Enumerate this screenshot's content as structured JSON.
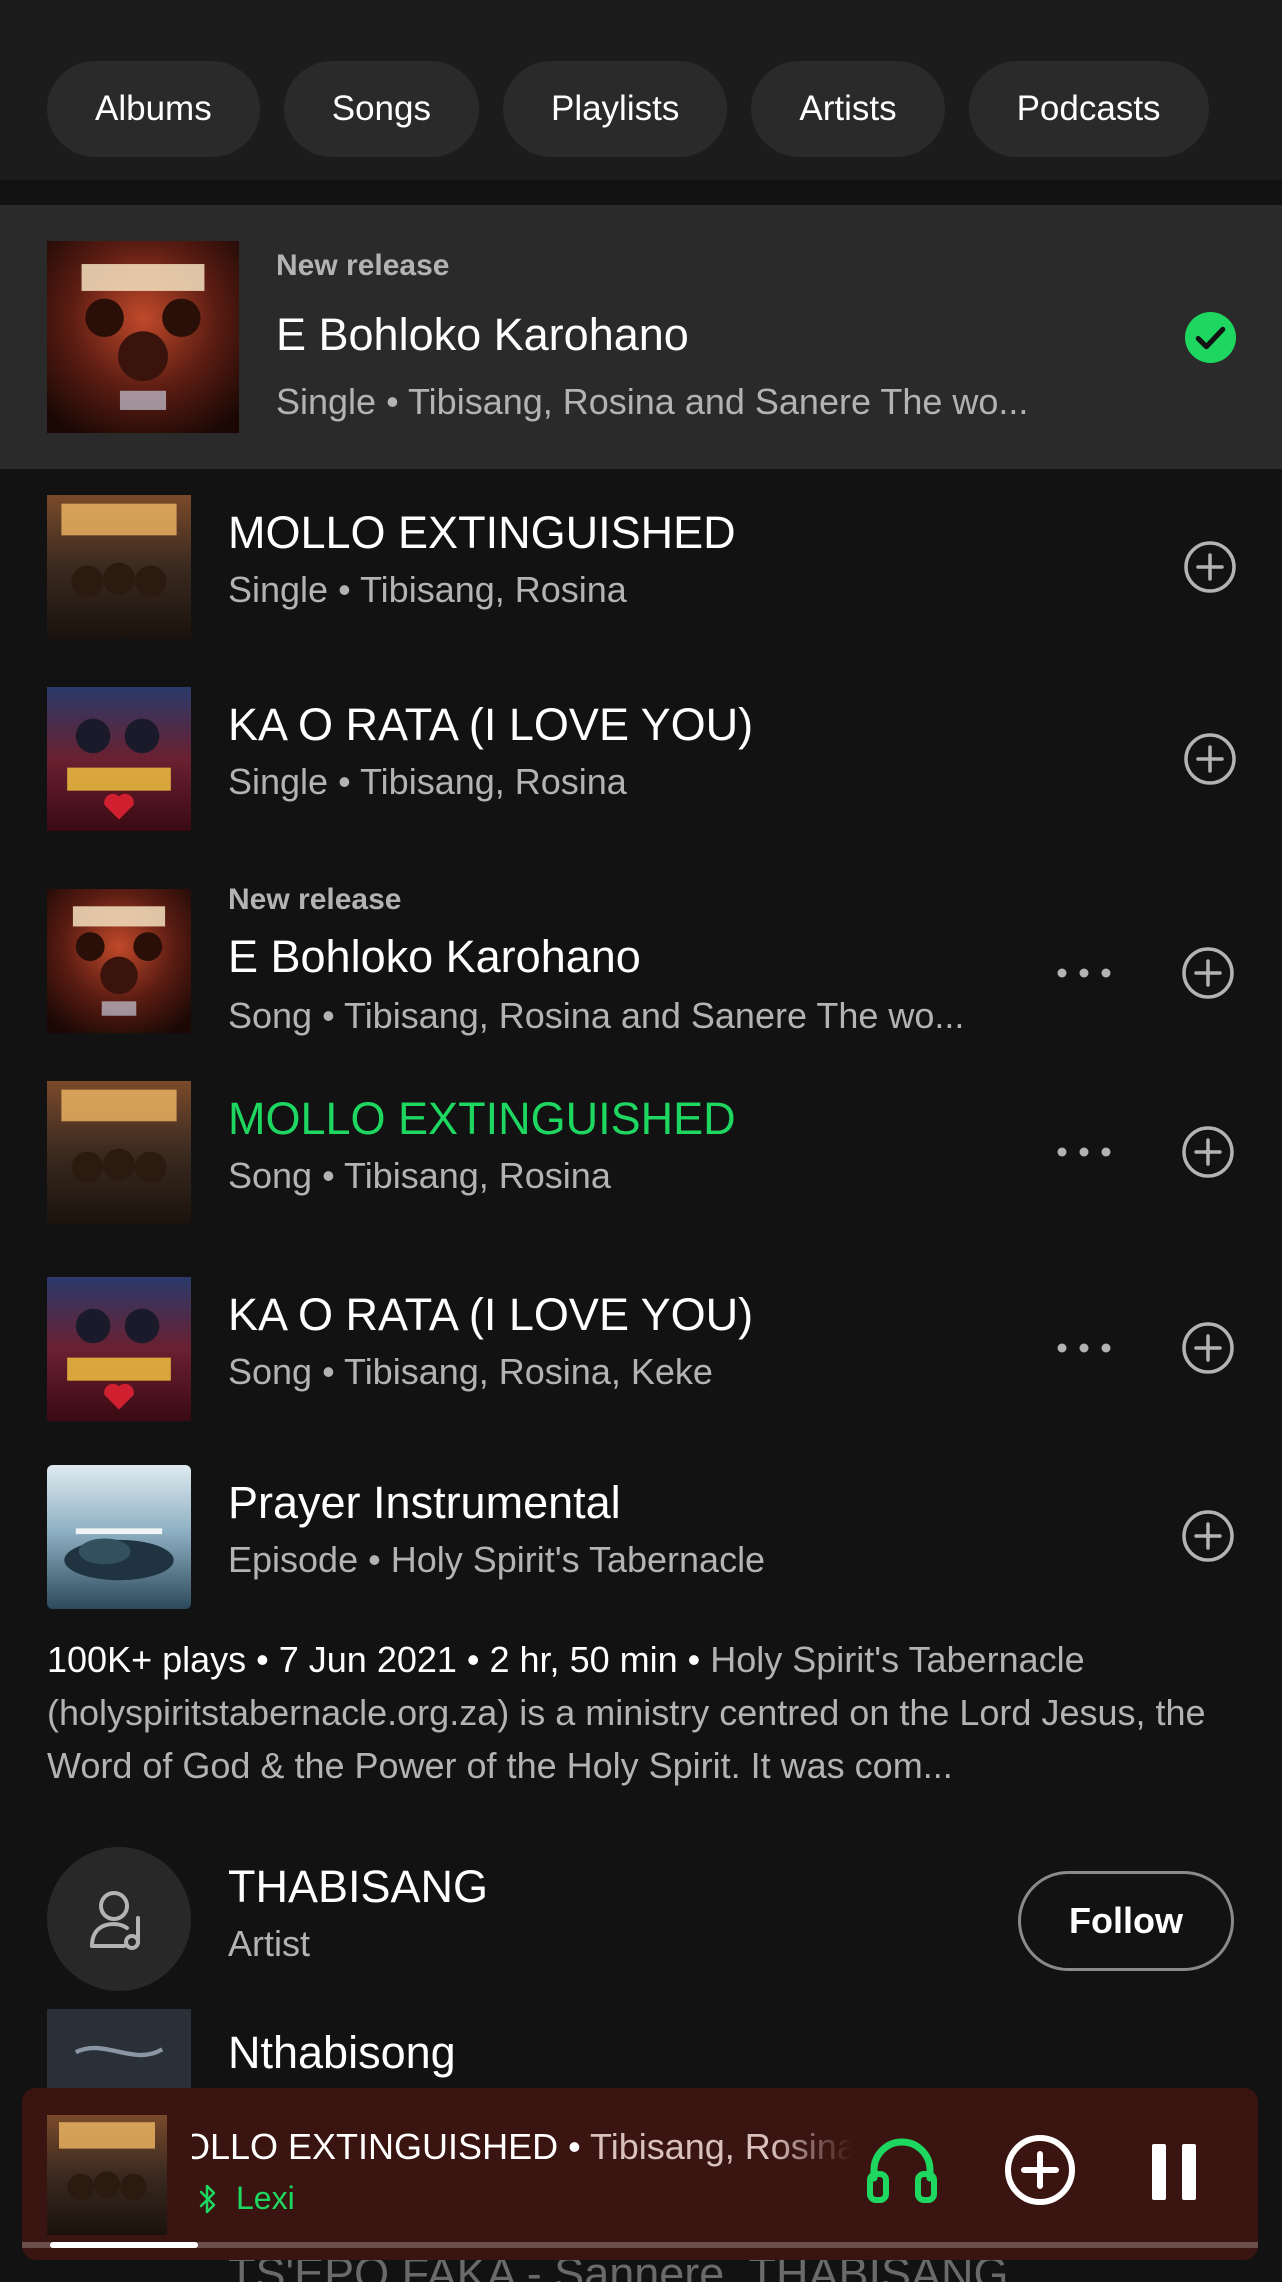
{
  "filters": [
    "Albums",
    "Songs",
    "Playlists",
    "Artists",
    "Podcasts"
  ],
  "top_result": {
    "badge": "New release",
    "title": "E Bohloko Karohano",
    "subtitle": "Single • Tibisang, Rosina and Sanere The wo..."
  },
  "rows": [
    {
      "title": "MOLLO EXTINGUISHED",
      "subtitle": "Single • Tibisang, Rosina"
    },
    {
      "title": "KA O RATA (I LOVE YOU)",
      "subtitle": "Single • Tibisang, Rosina"
    },
    {
      "badge": "New release",
      "title": "E Bohloko Karohano",
      "subtitle": "Song • Tibisang, Rosina and Sanere The wo..."
    },
    {
      "title": "MOLLO EXTINGUISHED",
      "subtitle": "Song • Tibisang, Rosina"
    },
    {
      "title": "KA O RATA (I LOVE YOU)",
      "subtitle": "Song • Tibisang, Rosina, Keke"
    },
    {
      "title": "Prayer Instrumental",
      "subtitle": "Episode • Holy Spirit's Tabernacle"
    }
  ],
  "episode": {
    "meta": "100K+ plays • 7 Jun 2021 • 2 hr, 50 min •",
    "description": "Holy Spirit's Tabernacle (holyspiritstabernacle.org.za) is a ministry centred on the Lord Jesus, the Word of God & the Power of the Holy Spirit. It was com..."
  },
  "artist": {
    "name": "THABISANG",
    "type": "Artist",
    "follow_label": "Follow"
  },
  "partial_row": {
    "title": "Nthabisong"
  },
  "ghost_text": "TS'EPO FAKA - Sannere, THABISANG",
  "now_playing": {
    "title": "MOLLO EXTINGUISHED",
    "separator": " • ",
    "artists": "Tibisang, Rosina",
    "device": "Lexi",
    "progress": 0.12
  },
  "colors": {
    "accent": "#1ed760",
    "background": "#121212",
    "player": "#3a1411"
  },
  "icons": [
    "check-circle-icon",
    "more-icon",
    "add-circle-icon",
    "artist-icon",
    "bluetooth-icon",
    "headphones-icon",
    "pause-icon"
  ]
}
